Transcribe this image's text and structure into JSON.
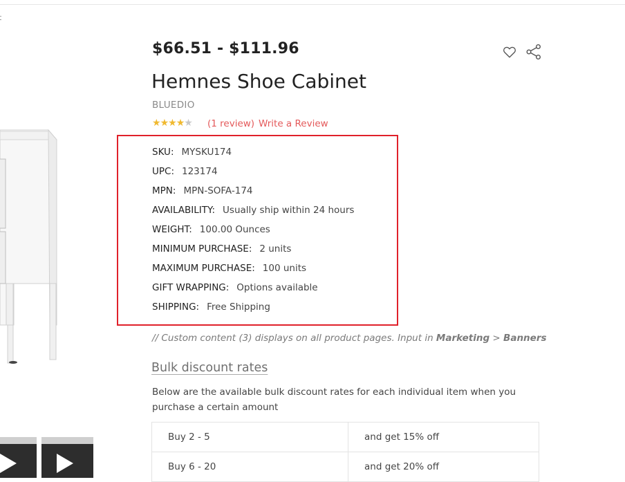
{
  "breadcrumb_fragment": "t",
  "product": {
    "price": "$66.51 - $111.96",
    "title": "Hemnes Shoe Cabinet",
    "brand": "BLUEDIO",
    "rating": {
      "value": 4,
      "max": 5
    },
    "review_count": "(1 review)",
    "write_review": "Write a Review"
  },
  "icons": [
    "heart-icon",
    "share-icon",
    "play-icon"
  ],
  "specs": [
    {
      "label": "SKU:",
      "value": "MYSKU174"
    },
    {
      "label": "UPC:",
      "value": "123174"
    },
    {
      "label": "MPN:",
      "value": "MPN-SOFA-174"
    },
    {
      "label": "AVAILABILITY:",
      "value": "Usually ship within 24 hours"
    },
    {
      "label": "WEIGHT:",
      "value": "100.00 Ounces"
    },
    {
      "label": "MINIMUM PURCHASE:",
      "value": "2 units"
    },
    {
      "label": "MAXIMUM PURCHASE:",
      "value": "100 units"
    },
    {
      "label": "GIFT WRAPPING:",
      "value": "Options available"
    },
    {
      "label": "SHIPPING:",
      "value": "Free Shipping"
    }
  ],
  "custom_content": {
    "text": "// Custom content (3) displays on all product pages. Input in ",
    "marketing": "Marketing",
    "sep": " > ",
    "banners": "Banners"
  },
  "bulk": {
    "title": "Bulk discount rates",
    "description": "Below are the available bulk discount rates for each individual item when you purchase a certain amount",
    "rows": [
      {
        "qty": "Buy 2 - 5",
        "discount": "and get 15% off"
      },
      {
        "qty": "Buy 6 - 20",
        "discount": "and get 20% off"
      }
    ]
  },
  "colors": {
    "accent_link": "#e4595a",
    "highlight_border": "#e0202a",
    "star": "#f0b930"
  }
}
